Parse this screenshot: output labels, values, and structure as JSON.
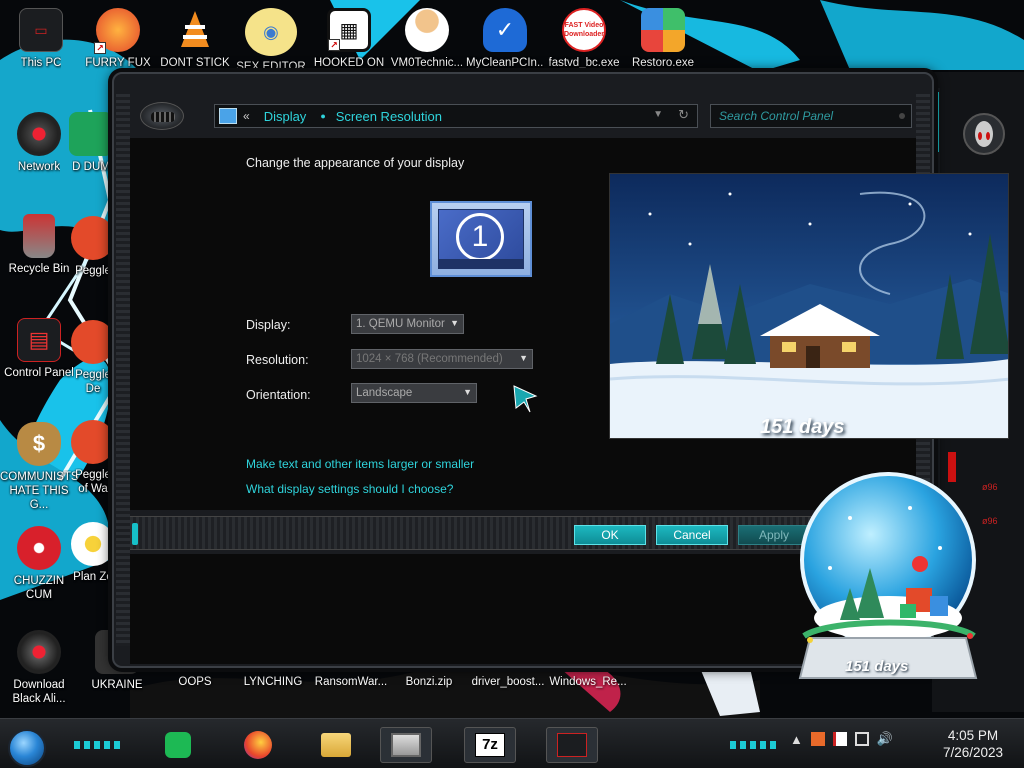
{
  "desktop": {
    "icons": [
      {
        "label": "This PC"
      },
      {
        "label": "FURRY FUX"
      },
      {
        "label": "DONT STICK"
      },
      {
        "label": "SEX EDITOR"
      },
      {
        "label": "HOOKED ON"
      },
      {
        "label": "VM0Technic..."
      },
      {
        "label": "MyCleanPCIn..."
      },
      {
        "label": "fastvd_bc.exe"
      },
      {
        "label": "Restoro.exe"
      },
      {
        "label": "Network"
      },
      {
        "label": "Recycle Bin"
      },
      {
        "label": "Control Panel"
      },
      {
        "label": "COMMUNISTS HATE THIS G..."
      },
      {
        "label": "CHUZZIN CUM"
      },
      {
        "label": "Download Black Ali..."
      },
      {
        "label": "D DUM"
      },
      {
        "label": "Peggle"
      },
      {
        "label": "Peggle De"
      },
      {
        "label": "Peggle of Wa"
      },
      {
        "label": "Plan Zo"
      },
      {
        "label": "UKRAINE"
      },
      {
        "label": "OOPS"
      },
      {
        "label": "LYNCHING"
      },
      {
        "label": "RansomWar..."
      },
      {
        "label": "Bonzi.zip"
      },
      {
        "label": "driver_boost..."
      },
      {
        "label": "Windows_Re..."
      }
    ],
    "fast_video_badge": "FAST Video Downloader"
  },
  "window": {
    "breadcrumb": {
      "back_chevron": "«",
      "display": "Display",
      "separator": "●",
      "screen_resolution": "Screen Resolution"
    },
    "search_placeholder": "Search Control Panel",
    "heading": "Change the appearance of your display",
    "monitor_number": "1",
    "display_label": "Display:",
    "display_value": "1. QEMU Monitor",
    "resolution_label": "Resolution:",
    "resolution_value": "1024 × 768 (Recommended)",
    "orientation_label": "Orientation:",
    "orientation_value": "Landscape",
    "link_text_size": "Make text and other items larger or smaller",
    "link_help": "What display settings should I choose?",
    "ok_label": "OK",
    "cancel_label": "Cancel",
    "apply_label": "Apply"
  },
  "gadgets": {
    "preview_caption": "151 days",
    "globe_caption": "151 days",
    "right_rail_labels": [
      "ø96",
      "ø96"
    ]
  },
  "taskbar": {
    "tasks": [
      {
        "icon": "spotify-icon"
      },
      {
        "icon": "firefox-icon"
      },
      {
        "icon": "file-explorer-icon"
      },
      {
        "icon": "display-settings-icon"
      },
      {
        "icon": "7zip-icon",
        "label": "7z"
      },
      {
        "icon": "alienware-app-icon"
      }
    ],
    "clock_time": "4:05 PM",
    "clock_date": "7/26/2023"
  },
  "colors": {
    "accent": "#2fd4dc",
    "button": "#16b8c0"
  }
}
